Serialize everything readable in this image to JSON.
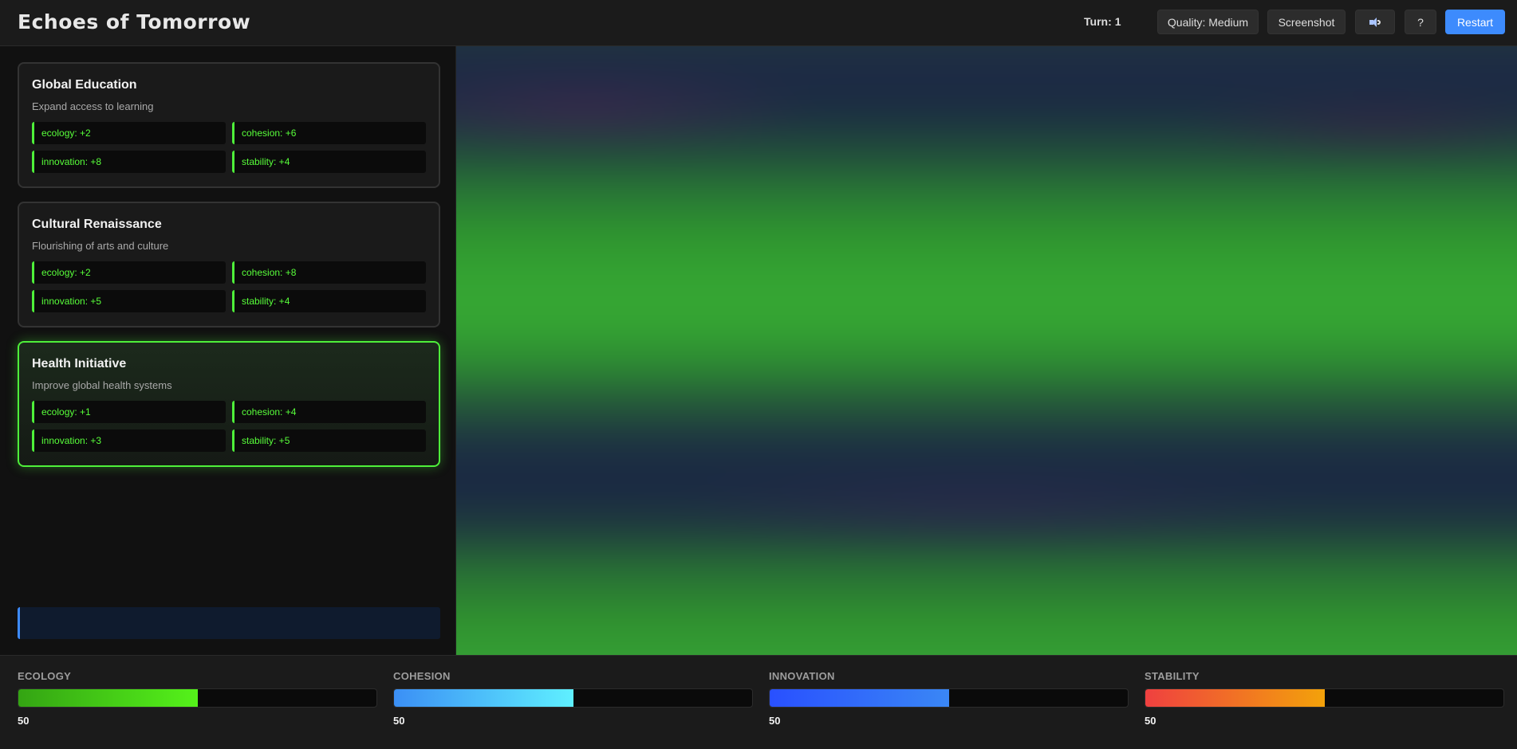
{
  "header": {
    "title": "Echoes of Tomorrow",
    "turn_label": "Turn:",
    "turn_value": "1",
    "quality_label": "Quality: Medium",
    "screenshot_label": "Screenshot",
    "help_label": "?",
    "restart_label": "Restart"
  },
  "cards": [
    {
      "title": "Global Education",
      "description": "Expand access to learning",
      "effects": [
        "ecology: +2",
        "cohesion: +6",
        "innovation: +8",
        "stability: +4"
      ],
      "selected": false
    },
    {
      "title": "Cultural Renaissance",
      "description": "Flourishing of arts and culture",
      "effects": [
        "ecology: +2",
        "cohesion: +8",
        "innovation: +5",
        "stability: +4"
      ],
      "selected": false
    },
    {
      "title": "Health Initiative",
      "description": "Improve global health systems",
      "effects": [
        "ecology: +1",
        "cohesion: +4",
        "innovation: +3",
        "stability: +5"
      ],
      "selected": true
    }
  ],
  "stats": [
    {
      "label": "ECOLOGY",
      "value": "50",
      "percent": 50
    },
    {
      "label": "COHESION",
      "value": "50",
      "percent": 50
    },
    {
      "label": "INNOVATION",
      "value": "50",
      "percent": 50
    },
    {
      "label": "STABILITY",
      "value": "50",
      "percent": 50
    }
  ],
  "colors": {
    "accent": "#3d8bfd",
    "selected": "#4ef03a",
    "effect_text": "#58ff3a"
  },
  "icons": {
    "sound": "speaker-icon"
  }
}
